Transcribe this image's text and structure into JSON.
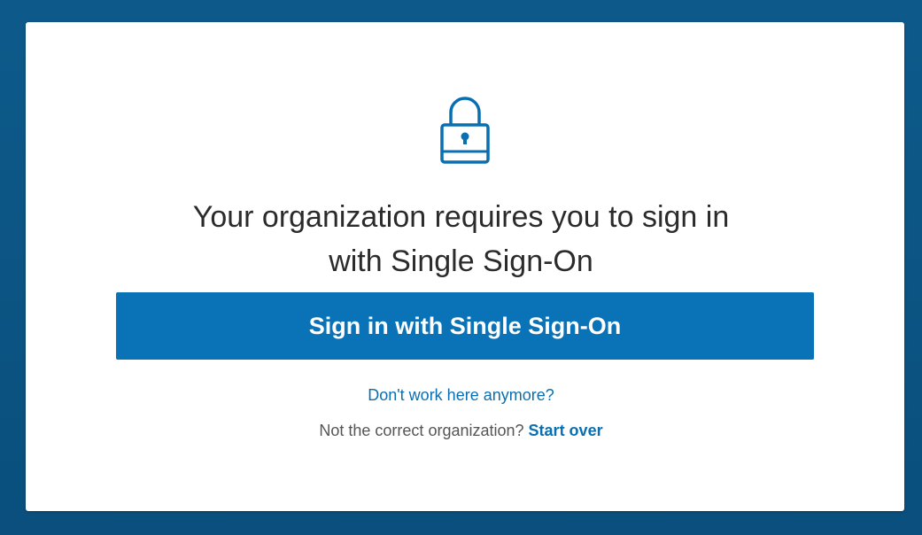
{
  "dialog": {
    "title_line1": "Your organization requires you to sign in",
    "title_line2": "with Single Sign-On",
    "sso_button_label": "Sign in with Single Sign-On",
    "dont_work_link": "Don't work here anymore?",
    "org_prompt": "Not the correct organization?",
    "start_over_link": "Start over",
    "lock_icon": "lock-icon"
  },
  "colors": {
    "background": "#0b5584",
    "card": "#ffffff",
    "accent": "#0a73b8",
    "link": "#0a6fb0",
    "title_text": "#2b2b2b",
    "muted_text": "#555555"
  }
}
